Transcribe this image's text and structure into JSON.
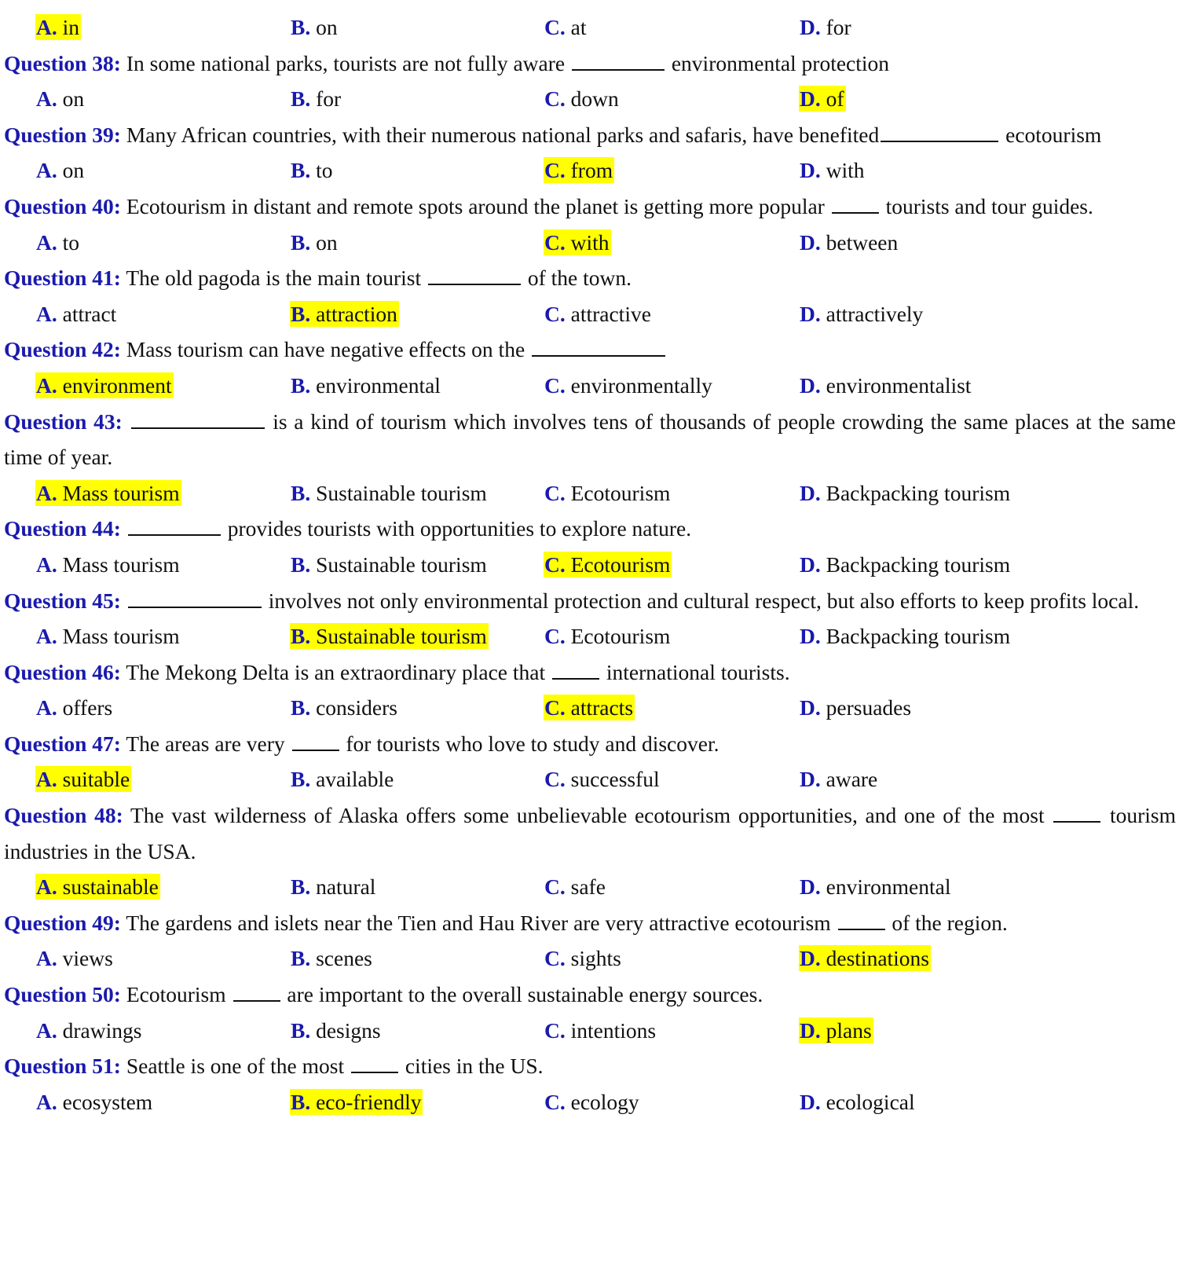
{
  "colors": {
    "option_letter": "#1a1aad",
    "question_label": "#1a1aad",
    "body_text": "#111111",
    "highlight": "#ffff00",
    "page_background": "#ffffff"
  },
  "option_columns": {
    "A": 45,
    "B": 369,
    "C": 692,
    "D": 1017
  },
  "blocks": [
    {
      "type": "options",
      "name": "options-row-q37",
      "options": [
        {
          "letter": "A.",
          "text": "in",
          "highlighted": true
        },
        {
          "letter": "B.",
          "text": "on",
          "highlighted": false
        },
        {
          "letter": "C.",
          "text": "at",
          "highlighted": false
        },
        {
          "letter": "D.",
          "text": "for",
          "highlighted": false
        }
      ]
    },
    {
      "type": "question",
      "name": "question-38",
      "label": "Question 38:",
      "segments": [
        {
          "kind": "text",
          "value": " In some national parks, tourists are not fully aware "
        },
        {
          "kind": "blank",
          "size": "b-md"
        },
        {
          "kind": "text",
          "value": " environmental protection"
        }
      ]
    },
    {
      "type": "options",
      "name": "options-row-q38",
      "options": [
        {
          "letter": "A.",
          "text": "on",
          "highlighted": false
        },
        {
          "letter": "B.",
          "text": "for",
          "highlighted": false
        },
        {
          "letter": "C.",
          "text": "down",
          "highlighted": false
        },
        {
          "letter": "D.",
          "text": "of",
          "highlighted": true
        }
      ]
    },
    {
      "type": "question",
      "name": "question-39",
      "label": "Question 39:",
      "segments": [
        {
          "kind": "text",
          "value": " Many African countries, with their numerous national parks and safaris, have benefited"
        },
        {
          "kind": "blank",
          "size": "b-lg"
        },
        {
          "kind": "text",
          "value": " ecotourism"
        }
      ]
    },
    {
      "type": "options",
      "name": "options-row-q39",
      "options": [
        {
          "letter": "A.",
          "text": "on",
          "highlighted": false
        },
        {
          "letter": "B.",
          "text": "to",
          "highlighted": false
        },
        {
          "letter": "C.",
          "text": "from",
          "highlighted": true
        },
        {
          "letter": "D.",
          "text": "with",
          "highlighted": false
        }
      ]
    },
    {
      "type": "question",
      "name": "question-40",
      "label": "Question 40:",
      "segments": [
        {
          "kind": "text",
          "value": " Ecotourism in distant and remote spots around the planet is getting more popular "
        },
        {
          "kind": "blank",
          "size": "b-sm"
        },
        {
          "kind": "text",
          "value": " tourists and tour guides."
        }
      ]
    },
    {
      "type": "options",
      "name": "options-row-q40",
      "options": [
        {
          "letter": "A.",
          "text": "to",
          "highlighted": false
        },
        {
          "letter": "B.",
          "text": "on",
          "highlighted": false
        },
        {
          "letter": "C.",
          "text": "with",
          "highlighted": true
        },
        {
          "letter": "D.",
          "text": "between",
          "highlighted": false
        }
      ]
    },
    {
      "type": "question",
      "name": "question-41",
      "label": "Question 41:",
      "segments": [
        {
          "kind": "text",
          "value": " The old pagoda is the main tourist "
        },
        {
          "kind": "blank",
          "size": "b-md"
        },
        {
          "kind": "text",
          "value": " of the town."
        }
      ]
    },
    {
      "type": "options",
      "name": "options-row-q41",
      "options": [
        {
          "letter": "A.",
          "text": "attract",
          "highlighted": false
        },
        {
          "letter": "B.",
          "text": "attraction",
          "highlighted": true
        },
        {
          "letter": "C.",
          "text": "attractive",
          "highlighted": false
        },
        {
          "letter": "D.",
          "text": "attractively",
          "highlighted": false
        }
      ]
    },
    {
      "type": "question",
      "name": "question-42",
      "label": "Question 42:",
      "segments": [
        {
          "kind": "text",
          "value": " Mass tourism can have negative effects on the "
        },
        {
          "kind": "blank",
          "size": "b-xl"
        }
      ]
    },
    {
      "type": "options",
      "name": "options-row-q42",
      "options": [
        {
          "letter": "A.",
          "text": "environment",
          "highlighted": true
        },
        {
          "letter": "B.",
          "text": "environmental",
          "highlighted": false
        },
        {
          "letter": "C.",
          "text": "environmentally",
          "highlighted": false
        },
        {
          "letter": "D.",
          "text": "environmentalist",
          "highlighted": false
        }
      ]
    },
    {
      "type": "question",
      "name": "question-43",
      "label": "Question 43:",
      "segments": [
        {
          "kind": "text",
          "value": " "
        },
        {
          "kind": "blank",
          "size": "b-xl"
        },
        {
          "kind": "text",
          "value": " is a kind of tourism which involves tens of thousands of people crowding the same places at the same time of year."
        }
      ]
    },
    {
      "type": "options",
      "name": "options-row-q43",
      "options": [
        {
          "letter": "A.",
          "text": "Mass tourism",
          "highlighted": true
        },
        {
          "letter": "B.",
          "text": "Sustainable tourism",
          "highlighted": false
        },
        {
          "letter": "C.",
          "text": "Ecotourism",
          "highlighted": false
        },
        {
          "letter": "D.",
          "text": "Backpacking tourism",
          "highlighted": false
        }
      ]
    },
    {
      "type": "question",
      "name": "question-44",
      "label": "Question 44:",
      "segments": [
        {
          "kind": "text",
          "value": " "
        },
        {
          "kind": "blank",
          "size": "b-md"
        },
        {
          "kind": "text",
          "value": " provides tourists with opportunities to explore nature."
        }
      ]
    },
    {
      "type": "options",
      "name": "options-row-q44",
      "options": [
        {
          "letter": "A.",
          "text": "Mass tourism",
          "highlighted": false
        },
        {
          "letter": "B.",
          "text": "Sustainable tourism",
          "highlighted": false
        },
        {
          "letter": "C.",
          "text": "Ecotourism",
          "highlighted": true
        },
        {
          "letter": "D.",
          "text": "Backpacking tourism",
          "highlighted": false
        }
      ]
    },
    {
      "type": "question",
      "name": "question-45",
      "label": "Question 45:",
      "segments": [
        {
          "kind": "text",
          "value": " "
        },
        {
          "kind": "blank",
          "size": "b-xl"
        },
        {
          "kind": "text",
          "value": " involves not only environmental protection and cultural respect, but also efforts to keep profits local."
        }
      ]
    },
    {
      "type": "options",
      "name": "options-row-q45",
      "options": [
        {
          "letter": "A.",
          "text": "Mass tourism",
          "highlighted": false
        },
        {
          "letter": "B.",
          "text": "Sustainable tourism",
          "highlighted": true
        },
        {
          "letter": "C.",
          "text": "Ecotourism",
          "highlighted": false
        },
        {
          "letter": "D.",
          "text": "Backpacking tourism",
          "highlighted": false
        }
      ]
    },
    {
      "type": "question",
      "name": "question-46",
      "label": "Question 46:",
      "segments": [
        {
          "kind": "text",
          "value": " The Mekong Delta is an extraordinary place that "
        },
        {
          "kind": "blank",
          "size": "b-sm"
        },
        {
          "kind": "text",
          "value": " international tourists."
        }
      ]
    },
    {
      "type": "options",
      "name": "options-row-q46",
      "options": [
        {
          "letter": "A.",
          "text": "offers",
          "highlighted": false
        },
        {
          "letter": "B.",
          "text": "considers",
          "highlighted": false
        },
        {
          "letter": "C.",
          "text": "attracts",
          "highlighted": true
        },
        {
          "letter": "D.",
          "text": "persuades",
          "highlighted": false
        }
      ]
    },
    {
      "type": "question",
      "name": "question-47",
      "label": "Question 47:",
      "segments": [
        {
          "kind": "text",
          "value": " The areas are very "
        },
        {
          "kind": "blank",
          "size": "b-sm"
        },
        {
          "kind": "text",
          "value": " for tourists who love to study and discover."
        }
      ]
    },
    {
      "type": "options",
      "name": "options-row-q47",
      "options": [
        {
          "letter": "A.",
          "text": "suitable",
          "highlighted": true
        },
        {
          "letter": "B.",
          "text": "available",
          "highlighted": false
        },
        {
          "letter": "C.",
          "text": "successful",
          "highlighted": false
        },
        {
          "letter": "D.",
          "text": "aware",
          "highlighted": false
        }
      ]
    },
    {
      "type": "question",
      "name": "question-48",
      "label": "Question 48:",
      "segments": [
        {
          "kind": "text",
          "value": " The vast wilderness of Alaska offers some unbelievable ecotourism opportunities, and one of the most "
        },
        {
          "kind": "blank",
          "size": "b-sm"
        },
        {
          "kind": "text",
          "value": " tourism industries in the USA."
        }
      ]
    },
    {
      "type": "options",
      "name": "options-row-q48",
      "options": [
        {
          "letter": "A.",
          "text": "sustainable",
          "highlighted": true
        },
        {
          "letter": "B.",
          "text": "natural",
          "highlighted": false
        },
        {
          "letter": "C.",
          "text": "safe",
          "highlighted": false
        },
        {
          "letter": "D.",
          "text": "environmental",
          "highlighted": false
        }
      ]
    },
    {
      "type": "question",
      "name": "question-49",
      "label": "Question 49:",
      "segments": [
        {
          "kind": "text",
          "value": " The gardens and islets near the Tien and Hau River are very attractive ecotourism "
        },
        {
          "kind": "blank",
          "size": "b-sm"
        },
        {
          "kind": "text",
          "value": " of the region."
        }
      ]
    },
    {
      "type": "options",
      "name": "options-row-q49",
      "options": [
        {
          "letter": "A.",
          "text": "views",
          "highlighted": false
        },
        {
          "letter": "B.",
          "text": "scenes",
          "highlighted": false
        },
        {
          "letter": "C.",
          "text": "sights",
          "highlighted": false
        },
        {
          "letter": "D.",
          "text": "destinations",
          "highlighted": true
        }
      ]
    },
    {
      "type": "question",
      "name": "question-50",
      "label": "Question 50:",
      "segments": [
        {
          "kind": "text",
          "value": " Ecotourism "
        },
        {
          "kind": "blank",
          "size": "b-sm"
        },
        {
          "kind": "text",
          "value": " are important to the overall sustainable energy sources."
        }
      ]
    },
    {
      "type": "options",
      "name": "options-row-q50",
      "options": [
        {
          "letter": "A.",
          "text": "drawings",
          "highlighted": false
        },
        {
          "letter": "B.",
          "text": "designs",
          "highlighted": false
        },
        {
          "letter": "C.",
          "text": "intentions",
          "highlighted": false
        },
        {
          "letter": "D.",
          "text": "plans",
          "highlighted": true
        }
      ]
    },
    {
      "type": "question",
      "name": "question-51",
      "label": "Question 51:",
      "segments": [
        {
          "kind": "text",
          "value": " Seattle is one of the most "
        },
        {
          "kind": "blank",
          "size": "b-sm"
        },
        {
          "kind": "text",
          "value": " cities in the US."
        }
      ]
    },
    {
      "type": "options",
      "name": "options-row-q51",
      "options": [
        {
          "letter": "A.",
          "text": "ecosystem",
          "highlighted": false
        },
        {
          "letter": "B.",
          "text": "eco-friendly",
          "highlighted": true
        },
        {
          "letter": "C.",
          "text": "ecology",
          "highlighted": false
        },
        {
          "letter": "D.",
          "text": "ecological",
          "highlighted": false
        }
      ]
    }
  ]
}
